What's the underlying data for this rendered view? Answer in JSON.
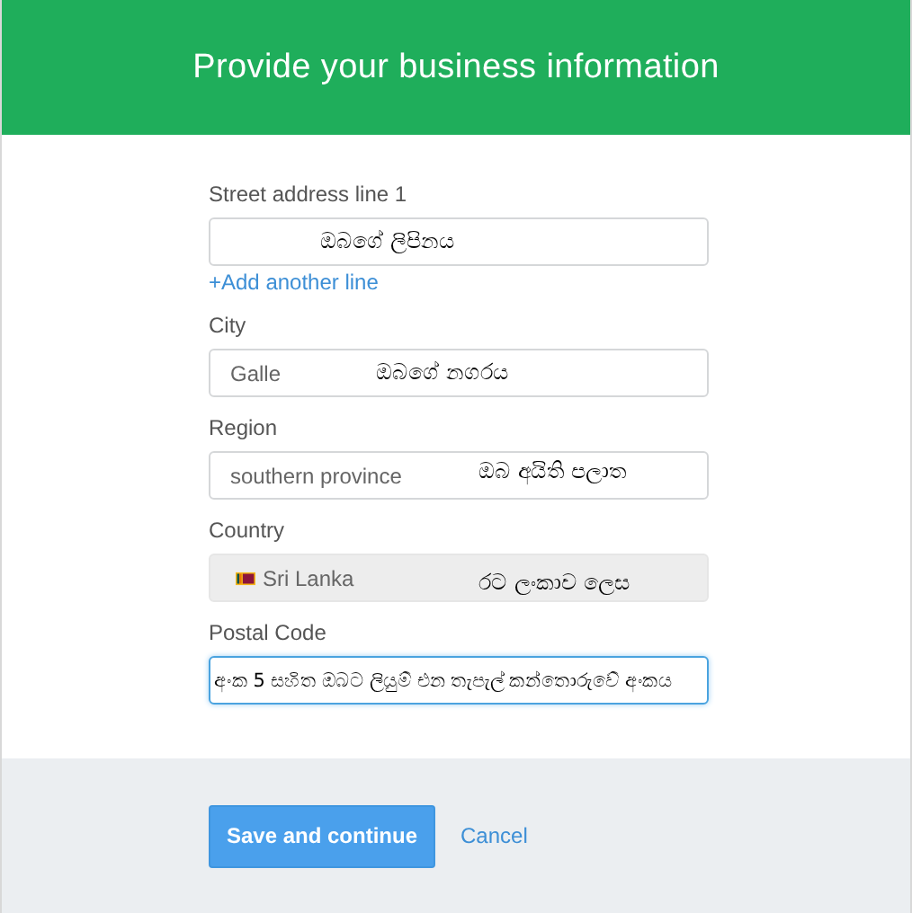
{
  "header": {
    "title": "Provide your business information"
  },
  "fields": [
    {
      "label": "Street address line 1",
      "kind": "text",
      "annotation": "ඔබගේ ලිපිනය",
      "focused": false,
      "link": "+Add another line"
    },
    {
      "label": "City",
      "kind": "text",
      "value": "Galle",
      "annotation": "ඔබගේ නගරය",
      "focused": false
    },
    {
      "label": "Region",
      "kind": "text",
      "value": "southern province",
      "annotation": "ඔබ අයිති පලාත",
      "focused": false
    },
    {
      "label": "Country",
      "kind": "select",
      "value": "Sri Lanka",
      "annotation": "රට ලංකාව ලෙස",
      "focused": false
    },
    {
      "label": "Postal Code",
      "kind": "text",
      "value": "අංක 5 සහිත ඔබට ලියුම් එන තැපැල් කන්තොරුවේ අංකය",
      "focused": true
    }
  ],
  "footer": {
    "primary_button": "Save and continue",
    "cancel_link": "Cancel"
  }
}
